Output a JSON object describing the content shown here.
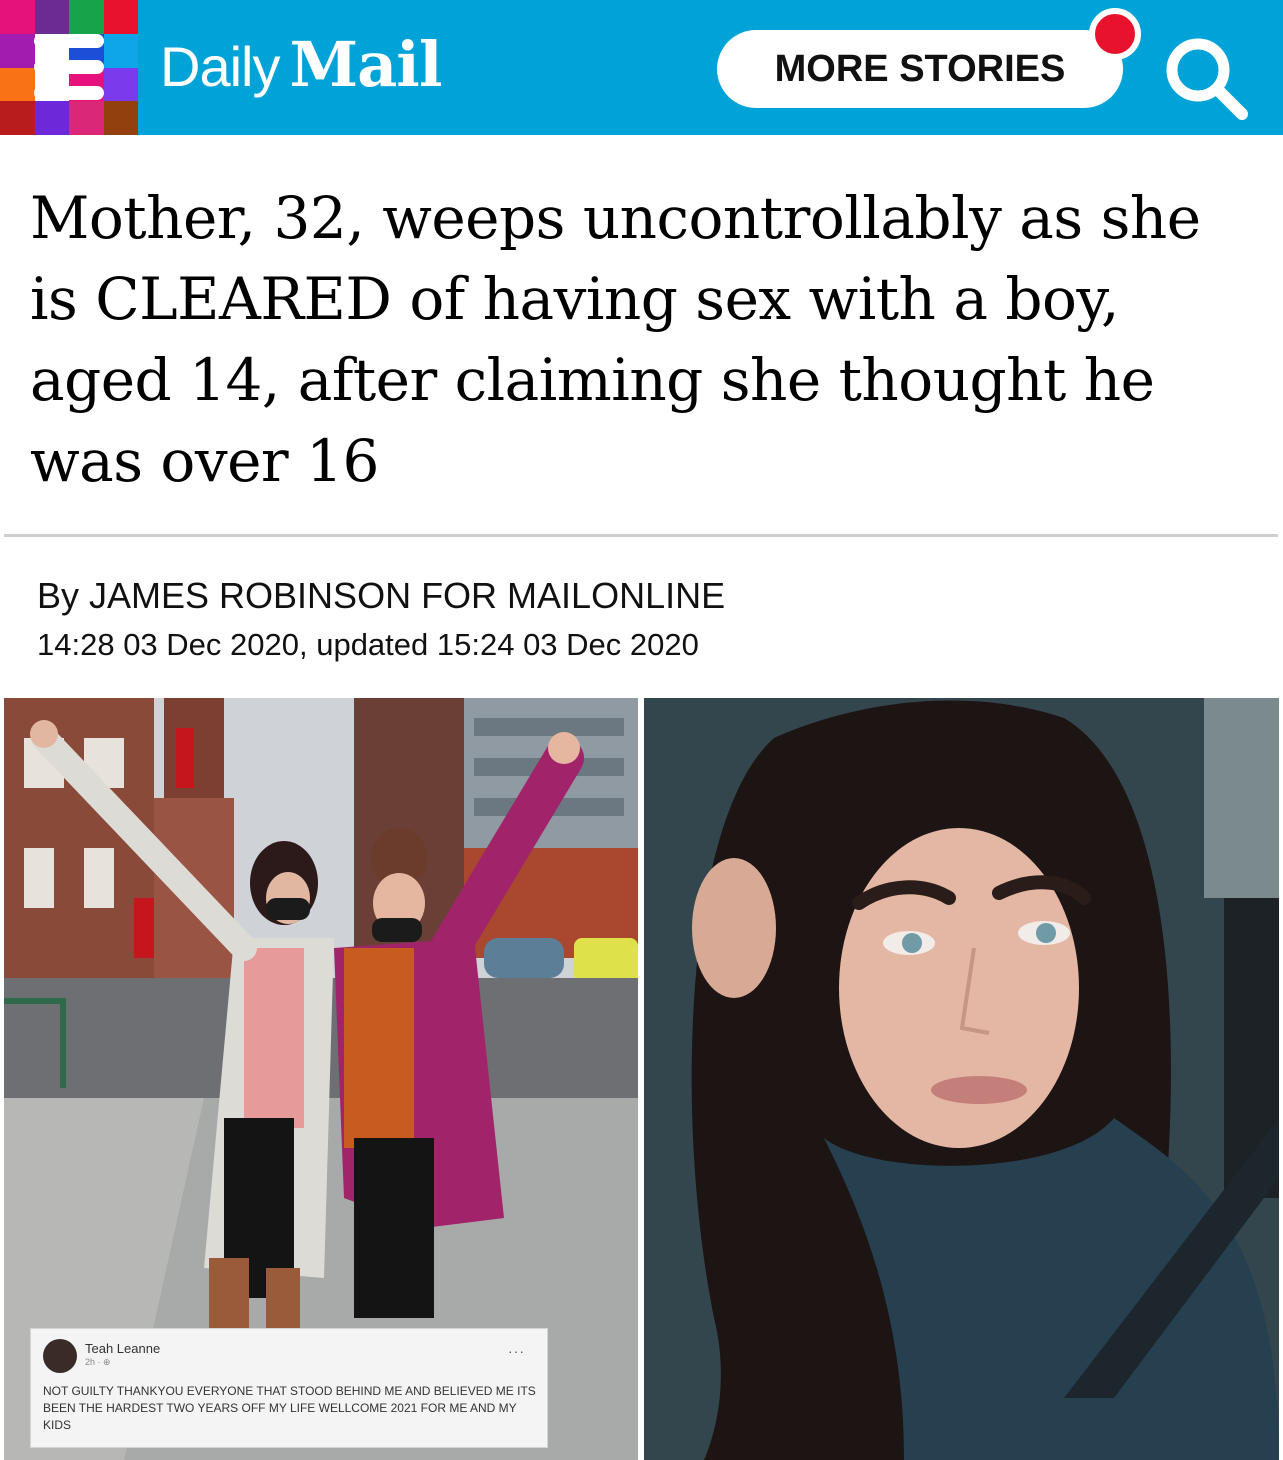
{
  "header": {
    "logo_daily": "Daily",
    "logo_mail": "Mail",
    "more_stories_label": "MORE STORIES",
    "mosaic_colors": [
      "#e4127a",
      "#6c2b91",
      "#16a34a",
      "#e8122d",
      "#a21caf",
      "#ffffff",
      "#1d4ed8",
      "#0ea5e9",
      "#f97316",
      "#ffffff",
      "#e4127a",
      "#7c3aed",
      "#b91c1c",
      "#6d28d9",
      "#db2777",
      "#92400e"
    ],
    "brand_color": "#00a3d7",
    "notification_color": "#e8122d"
  },
  "article": {
    "headline": "Mother, 32, weeps uncontrollably as she is CLEARED of having sex with a boy, aged 14, after claiming she thought he was over 16",
    "byline": "By JAMES ROBINSON FOR MAILONLINE",
    "dateline": "14:28 03 Dec 2020, updated 15:24 03 Dec 2020"
  },
  "facebook_post": {
    "name": "Teah Leanne",
    "time": "2h · ⊕",
    "dots": "···",
    "text": "NOT GUILTY THANKYOU EVERYONE THAT STOOD BEHIND ME AND BELIEVED ME ITS BEEN THE HARDEST TWO YEARS OFF MY LIFE WELLCOME 2021 FOR ME AND MY KIDS"
  }
}
